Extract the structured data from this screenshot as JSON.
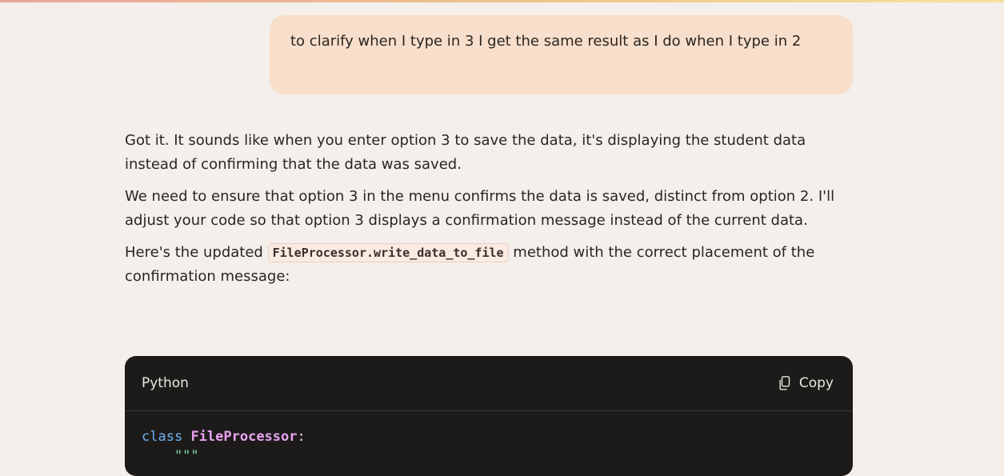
{
  "user_message": {
    "text": "to clarify when I type in 3 I get the same result as I do when I type in 2"
  },
  "assistant_message": {
    "paragraph_1": "Got it. It sounds like when you enter option 3 to save the data, it's displaying the student data instead of confirming that the data was saved.",
    "paragraph_2": "We need to ensure that option 3 in the menu confirms the data is saved, distinct from option 2. I'll adjust your code so that option 3 displays a confirmation message instead of the current data.",
    "paragraph_3_prefix": "Here's the updated ",
    "paragraph_3_code": "FileProcessor.write_data_to_file",
    "paragraph_3_suffix": " method with the correct placement of the confirmation message:"
  },
  "code_block": {
    "language": "Python",
    "copy_label": "Copy",
    "copy_icon": "copy-icon",
    "line_1_keyword": "class",
    "line_1_name": "FileProcessor",
    "line_1_colon": ":",
    "line_2_docstring": "    \"\"\""
  },
  "colors": {
    "background": "#f4efeb",
    "user_bubble": "#f8dfcb",
    "code_background": "#1c1b1a",
    "keyword": "#6fb0f0",
    "class_name": "#e8a3f0",
    "string": "#7fd7a0"
  }
}
